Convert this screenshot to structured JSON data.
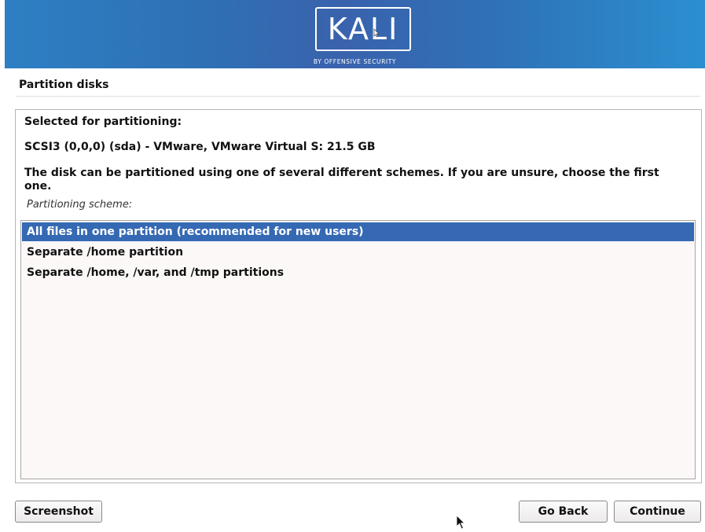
{
  "banner": {
    "logo_text": "KALI",
    "logo_subtitle": "BY OFFENSIVE SECURITY",
    "colors": {
      "gradient_left": "#2e7fc4",
      "gradient_mid": "#3a62ad",
      "gradient_right": "#2b8fd0"
    }
  },
  "page": {
    "title": "Partition disks"
  },
  "content": {
    "selected_label": "Selected for partitioning:",
    "disk": "SCSI3 (0,0,0) (sda) - VMware, VMware Virtual S: 21.5 GB",
    "description": "The disk can be partitioned using one of several different schemes. If you are unsure, choose the first one.",
    "scheme_label": "Partitioning scheme:",
    "schemes": [
      {
        "label": "All files in one partition (recommended for new users)",
        "selected": true
      },
      {
        "label": "Separate /home partition",
        "selected": false
      },
      {
        "label": "Separate /home, /var, and /tmp partitions",
        "selected": false
      }
    ],
    "selection_color": "#3569b3"
  },
  "buttons": {
    "screenshot": "Screenshot",
    "go_back": "Go Back",
    "continue": "Continue"
  },
  "icons": {
    "mouse_cursor": "arrow-cursor-icon"
  }
}
